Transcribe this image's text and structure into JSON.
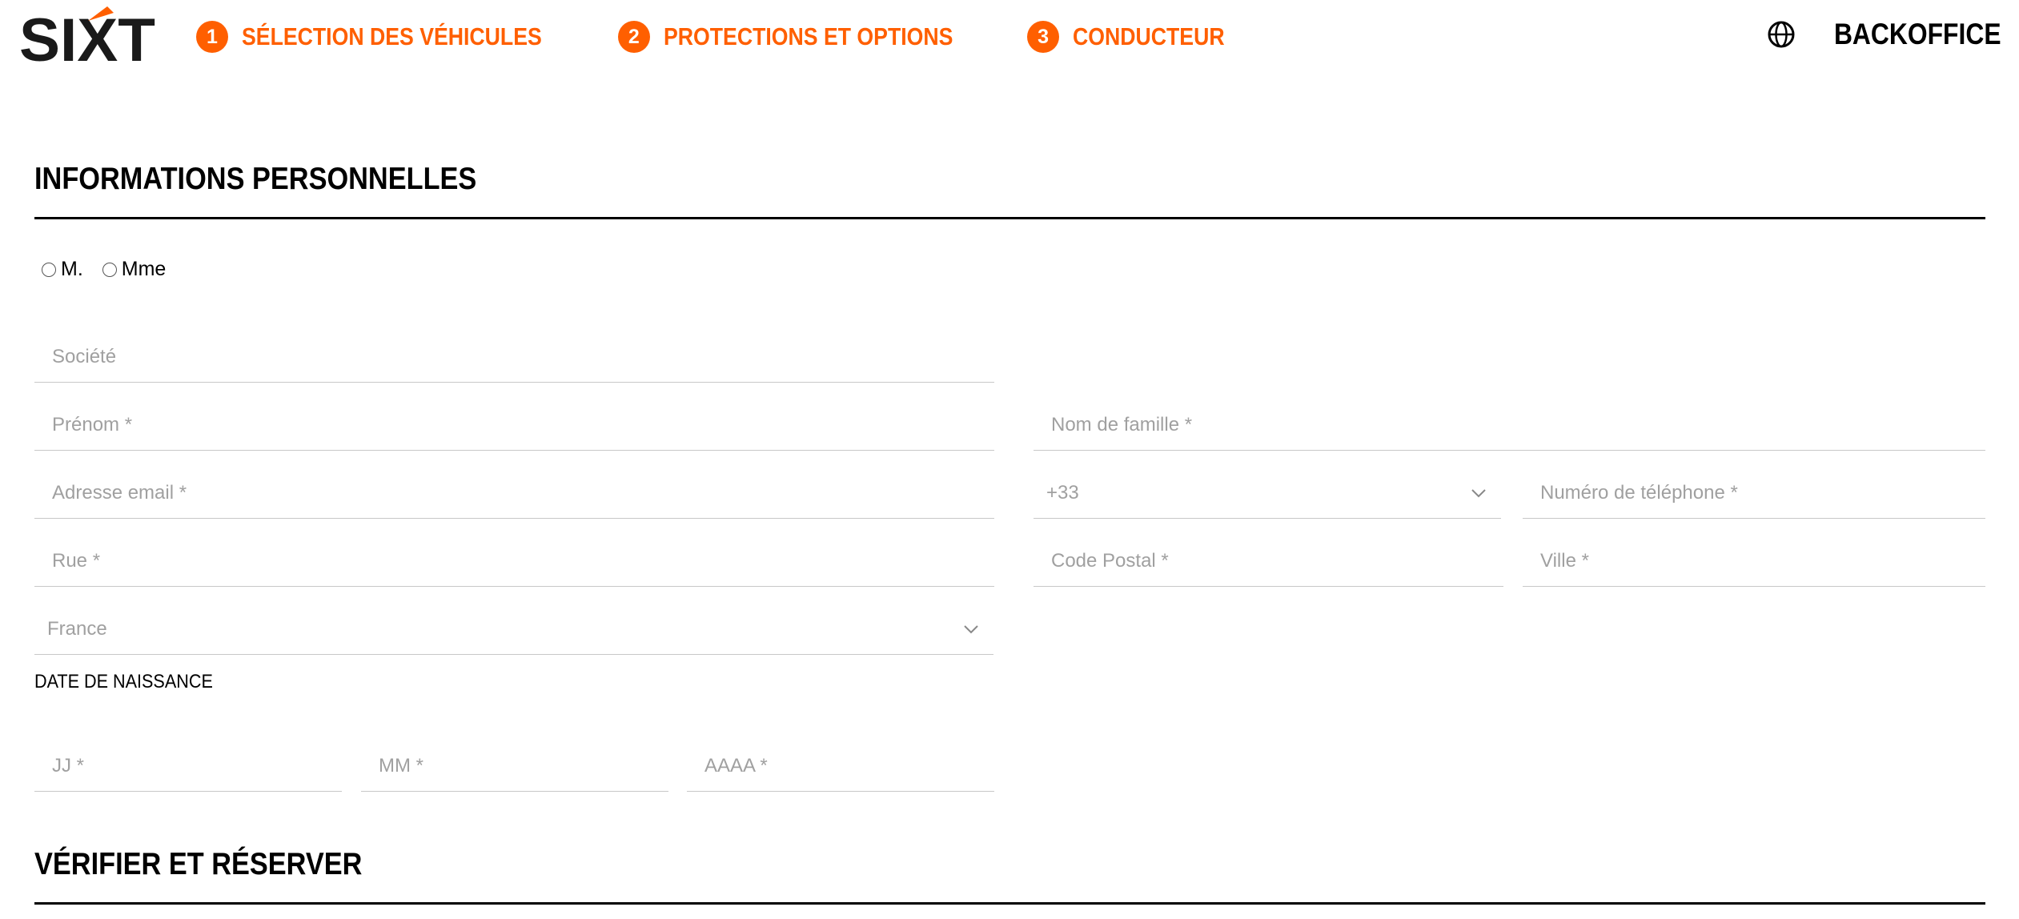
{
  "header": {
    "brand": "SIXT",
    "steps": [
      {
        "number": "1",
        "label": "SÉLECTION DES VÉHICULES"
      },
      {
        "number": "2",
        "label": "PROTECTIONS ET OPTIONS"
      },
      {
        "number": "3",
        "label": "CONDUCTEUR"
      }
    ],
    "backoffice_label": "BACKOFFICE",
    "accent_color": "#ff5f00"
  },
  "personal_info": {
    "title": "INFORMATIONS PERSONNELLES",
    "salutations": [
      "M.",
      "Mme"
    ],
    "fields": {
      "company": "Société",
      "first_name": "Prénom *",
      "last_name": "Nom de famille *",
      "email": "Adresse email *",
      "phone_prefix": "+33",
      "phone": "Numéro de téléphone *",
      "street": "Rue *",
      "postal_code": "Code Postal *",
      "city": "Ville *",
      "country": "France"
    },
    "dob": {
      "label": "DATE DE NAISSANCE",
      "day": "JJ *",
      "month": "MM *",
      "year": "AAAA *"
    }
  },
  "verify": {
    "title": "VÉRIFIER ET RÉSERVER"
  }
}
